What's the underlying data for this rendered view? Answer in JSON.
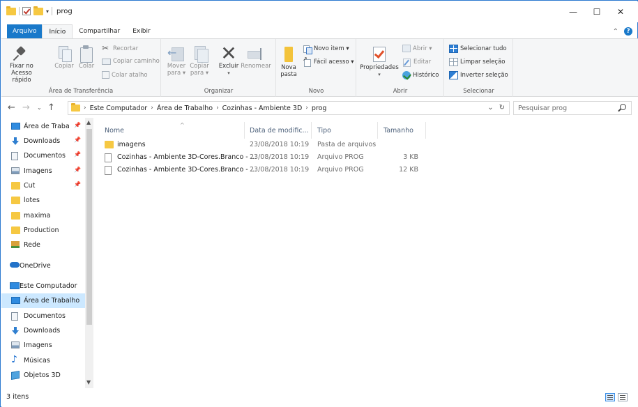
{
  "window": {
    "title": "prog",
    "controls": {
      "minimize": "—",
      "maximize": "☐",
      "close": "✕"
    }
  },
  "ribbon_tabs": [
    {
      "label": "Arquivo"
    },
    {
      "label": "Início"
    },
    {
      "label": "Compartilhar"
    },
    {
      "label": "Exibir"
    }
  ],
  "ribbon": {
    "clipboard": {
      "label": "Área de Transferência",
      "pin": "Fixar no\nAcesso rápido",
      "copy": "Copiar",
      "paste": "Colar",
      "cut": "Recortar",
      "copy_path": "Copiar caminho",
      "paste_shortcut": "Colar atalho"
    },
    "organize": {
      "label": "Organizar",
      "move_to": "Mover\npara ▾",
      "copy_to": "Copiar\npara ▾",
      "delete": "Excluir",
      "rename": "Renomear"
    },
    "new": {
      "label": "Novo",
      "new_folder": "Nova\npasta",
      "new_item": "Novo item ▾",
      "easy_access": "Fácil acesso ▾"
    },
    "open": {
      "label": "Abrir",
      "properties": "Propriedades",
      "open": "Abrir ▾",
      "edit": "Editar",
      "history": "Histórico"
    },
    "select": {
      "label": "Selecionar",
      "select_all": "Selecionar tudo",
      "select_none": "Limpar seleção",
      "invert": "Inverter seleção"
    }
  },
  "address": {
    "breadcrumb": [
      "Este Computador",
      "Área de Trabalho",
      "Cozinhas - Ambiente 3D",
      "prog"
    ],
    "search_placeholder": "Pesquisar prog"
  },
  "nav": {
    "items": [
      {
        "label": "Área de Traba",
        "icon": "desktop-icon",
        "pinned": true
      },
      {
        "label": "Downloads",
        "icon": "download-icon",
        "pinned": true
      },
      {
        "label": "Documentos",
        "icon": "document-icon",
        "pinned": true
      },
      {
        "label": "Imagens",
        "icon": "pictures-icon",
        "pinned": true
      },
      {
        "label": "Cut",
        "icon": "folder-icon",
        "pinned": true
      },
      {
        "label": "lotes",
        "icon": "folder-icon",
        "pinned": false
      },
      {
        "label": "maxima",
        "icon": "folder-icon",
        "pinned": false
      },
      {
        "label": "Production",
        "icon": "folder-icon",
        "pinned": false
      },
      {
        "label": "Rede",
        "icon": "network-icon",
        "pinned": false
      },
      {
        "label": "OneDrive",
        "icon": "onedrive-icon",
        "pinned": false
      },
      {
        "label": "Este Computador",
        "icon": "computer-icon",
        "pinned": false
      },
      {
        "label": "Área de Trabalho",
        "icon": "desktop-icon",
        "pinned": false,
        "selected": true
      },
      {
        "label": "Documentos",
        "icon": "document-icon",
        "pinned": false
      },
      {
        "label": "Downloads",
        "icon": "download-icon",
        "pinned": false
      },
      {
        "label": "Imagens",
        "icon": "pictures-icon",
        "pinned": false
      },
      {
        "label": "Músicas",
        "icon": "music-icon",
        "pinned": false
      },
      {
        "label": "Objetos 3D",
        "icon": "objects3d-icon",
        "pinned": false
      }
    ]
  },
  "columns": {
    "name": "Nome",
    "date": "Data de modific...",
    "type": "Tipo",
    "size": "Tamanho"
  },
  "files": [
    {
      "name": "imagens",
      "date": "23/08/2018 10:19",
      "type": "Pasta de arquivos",
      "size": "",
      "kind": "folder"
    },
    {
      "name": "Cozinhas - Ambiente 3D-Cores.Branco - ...",
      "date": "23/08/2018 10:19",
      "type": "Arquivo PROG",
      "size": "3 KB",
      "kind": "file"
    },
    {
      "name": "Cozinhas - Ambiente 3D-Cores.Branco - ...",
      "date": "23/08/2018 10:19",
      "type": "Arquivo PROG",
      "size": "12 KB",
      "kind": "file"
    }
  ],
  "status": {
    "count": "3 itens"
  },
  "colors": {
    "accent": "#1979ca",
    "selection": "#cce8ff",
    "folder": "#f6c842"
  }
}
